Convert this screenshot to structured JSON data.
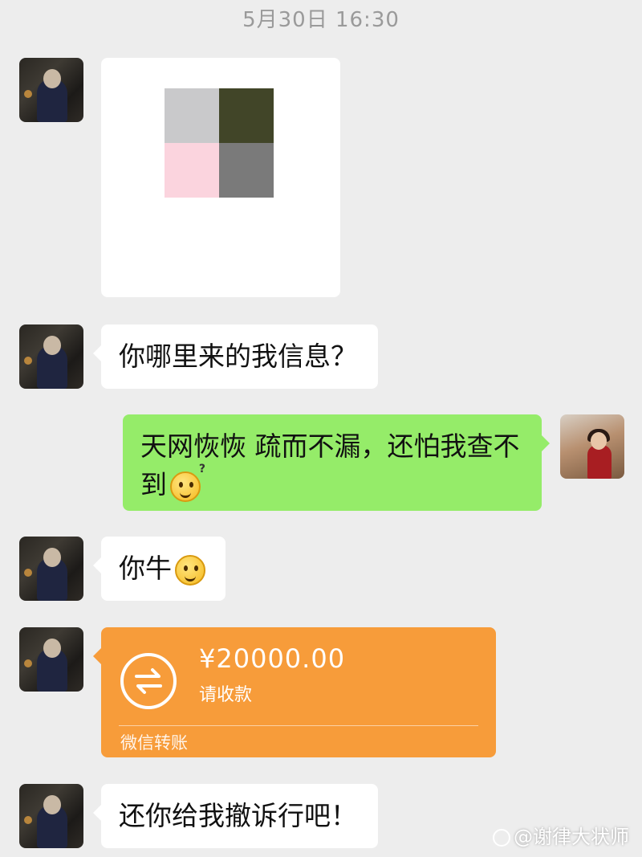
{
  "timestamp": "5月30日 16:30",
  "messages": {
    "m2_text": "你哪里来的我信息？",
    "m3_text": "天网恢恢 疏而不漏，还怕我查不到",
    "m4_text": "你牛",
    "m6_text": "还你给我撤诉行吧！"
  },
  "mosaic_colors": [
    "#c9c9cb",
    "#414528",
    "#fbd4de",
    "#7a7a7a"
  ],
  "transfer": {
    "amount": "¥20000.00",
    "status": "请收款",
    "label": "微信转账",
    "color": "#f79c3a"
  },
  "watermark": "@谢律大状师",
  "colors": {
    "background": "#ededed",
    "sent_bubble": "#95ec69",
    "received_bubble": "#ffffff"
  },
  "icons": {
    "transfer": "transfer-arrows-icon",
    "emoji_thinking": "thinking-question-emoji",
    "emoji_smile": "smile-emoji"
  }
}
